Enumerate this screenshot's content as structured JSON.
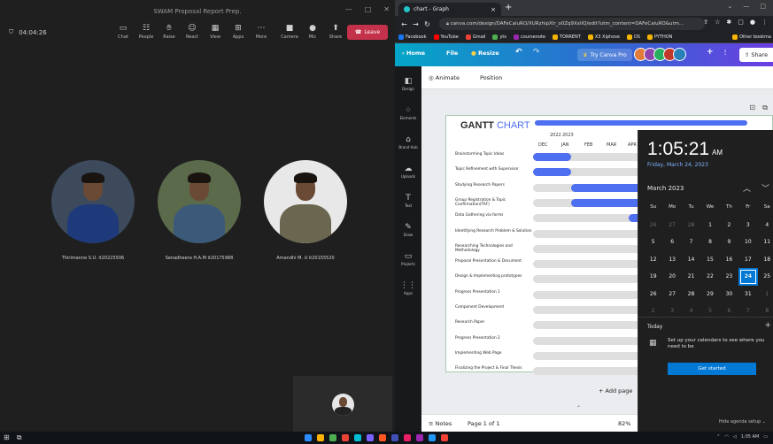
{
  "teams": {
    "window_title": "SWAM Proposal Report Prep.",
    "meeting_timer": "04:04:26",
    "tools": [
      {
        "label": "Chat",
        "icon": "chat-icon"
      },
      {
        "label": "People",
        "icon": "people-icon"
      },
      {
        "label": "Raise",
        "icon": "raise-hand-icon"
      },
      {
        "label": "React",
        "icon": "react-icon"
      },
      {
        "label": "View",
        "icon": "view-icon"
      },
      {
        "label": "Apps",
        "icon": "apps-icon"
      },
      {
        "label": "More",
        "icon": "more-icon"
      },
      {
        "label": "Camera",
        "icon": "camera-icon"
      },
      {
        "label": "Mic",
        "icon": "mic-icon"
      },
      {
        "label": "Share",
        "icon": "share-icon"
      }
    ],
    "leave_label": "Leave",
    "participants": [
      {
        "name": "Thirimanne S.U. it20225506",
        "shirt": "#1e3a7a",
        "bg": "#3d4a5c"
      },
      {
        "name": "Senadheera H.A.M it20175988",
        "shirt": "#3b5a7a",
        "bg": "#5a6a4a"
      },
      {
        "name": "Amandhi M. U it20155520",
        "shirt": "#6a6650",
        "bg": "#e8e8e8"
      }
    ]
  },
  "browser": {
    "tab_title": "chart - Graph",
    "url": "canva.com/design/DAFeCaluRO/XURzhipXlr_o0Zq9XxlIQ/edit?utm_content=DAFeCaluRO&utm...",
    "bookmarks": [
      {
        "label": "Facebook",
        "color": "#1877f2"
      },
      {
        "label": "YouTube",
        "color": "#ff0000"
      },
      {
        "label": "Gmail",
        "color": "#ea4335"
      },
      {
        "label": "yts",
        "color": "#4caf50"
      },
      {
        "label": "coursenote",
        "color": "#9c27b0"
      },
      {
        "label": "TORRENT",
        "color": "#f4b400"
      },
      {
        "label": "X3 Xiphose",
        "color": "#f4b400"
      },
      {
        "label": "DS",
        "color": "#f4b400"
      },
      {
        "label": "PYTHON",
        "color": "#f4b400"
      }
    ],
    "other_bookmarks": "Other bookma"
  },
  "canva": {
    "home_label": "Home",
    "file_label": "File",
    "resize_label": "Resize",
    "try_label": "Try Canva Pro",
    "share_label": "Share",
    "collab_colors": [
      "#e07b39",
      "#8e44ad",
      "#27ae60",
      "#c0392b",
      "#2980b9"
    ],
    "sidebar": [
      "Design",
      "Elements",
      "Brand Hub",
      "Uploads",
      "Text",
      "Draw",
      "Projects",
      "Apps"
    ],
    "animate_label": "Animate",
    "position_label": "Position",
    "add_page": "+ Add page",
    "notes_label": "Notes",
    "page_label": "Page 1 of 1",
    "zoom": "82%"
  },
  "chart_data": {
    "type": "bar",
    "title_dark": "GANTT",
    "title_blue": "CHART",
    "years": [
      "2022",
      "2023"
    ],
    "months": [
      "DEC",
      "JAN",
      "FEB",
      "MAR",
      "APR"
    ],
    "tasks": [
      {
        "name": "Brainstorming Topic Ideas",
        "start": 0.0,
        "end": 0.2
      },
      {
        "name": "Topic Refinement with Supervisor",
        "start": 0.0,
        "end": 0.2
      },
      {
        "name": "Studying Research Papers",
        "start": 0.2,
        "end": 1.0
      },
      {
        "name": "Group Registration & Topic Confirmation(TAF)",
        "start": 0.2,
        "end": 0.6
      },
      {
        "name": "Data Gathering via forms",
        "start": 0.5,
        "end": 0.85
      },
      {
        "name": "Identifying Research Problem & Solution",
        "start": 0.7,
        "end": 1.0
      },
      {
        "name": "Researching Technologies and Methodology",
        "start": 0.7,
        "end": 1.0
      },
      {
        "name": "Proposal Presentation & Document",
        "start": 0.7,
        "end": 1.0
      },
      {
        "name": "Design & Implementing prototypes",
        "start": 0.0,
        "end": 0.0
      },
      {
        "name": "Progress Presentation 1",
        "start": 0.0,
        "end": 0.0
      },
      {
        "name": "Component Development",
        "start": 0.0,
        "end": 0.0
      },
      {
        "name": "Research Paper",
        "start": 0.0,
        "end": 0.0
      },
      {
        "name": "Progress Presentation 2",
        "start": 0.0,
        "end": 0.0
      },
      {
        "name": "Implementing Web Page",
        "start": 0.0,
        "end": 0.0
      },
      {
        "name": "Finalizing the Project & Final Thesis",
        "start": 0.0,
        "end": 0.0
      }
    ]
  },
  "calendar": {
    "time": "1:05:21",
    "ampm": "AM",
    "date": "Friday, March 24, 2023",
    "month": "March 2023",
    "weekdays": [
      "Su",
      "Mo",
      "Tu",
      "We",
      "Th",
      "Fr",
      "Sa"
    ],
    "weeks": [
      [
        "26",
        "27",
        "28",
        "1",
        "2",
        "3",
        "4"
      ],
      [
        "5",
        "6",
        "7",
        "8",
        "9",
        "10",
        "11"
      ],
      [
        "12",
        "13",
        "14",
        "15",
        "16",
        "17",
        "18"
      ],
      [
        "19",
        "20",
        "21",
        "22",
        "23",
        "24",
        "25"
      ],
      [
        "26",
        "27",
        "28",
        "29",
        "30",
        "31",
        "1"
      ],
      [
        "2",
        "3",
        "4",
        "5",
        "6",
        "7",
        "8"
      ]
    ],
    "today_label": "Today",
    "set_up_msg": "Set up your calendars to see where you need to be",
    "get_started": "Get started",
    "hide_label": "Hide agenda setup"
  },
  "taskbar": {
    "time": "1:05 AM",
    "app_colors": [
      "#2d8cff",
      "#ffb300",
      "#4caf50",
      "#ea4335",
      "#00bcd4",
      "#7b61ff",
      "#ff5722",
      "#3f51b5",
      "#e91e63",
      "#9c27b0",
      "#2196f3",
      "#f44336"
    ]
  }
}
